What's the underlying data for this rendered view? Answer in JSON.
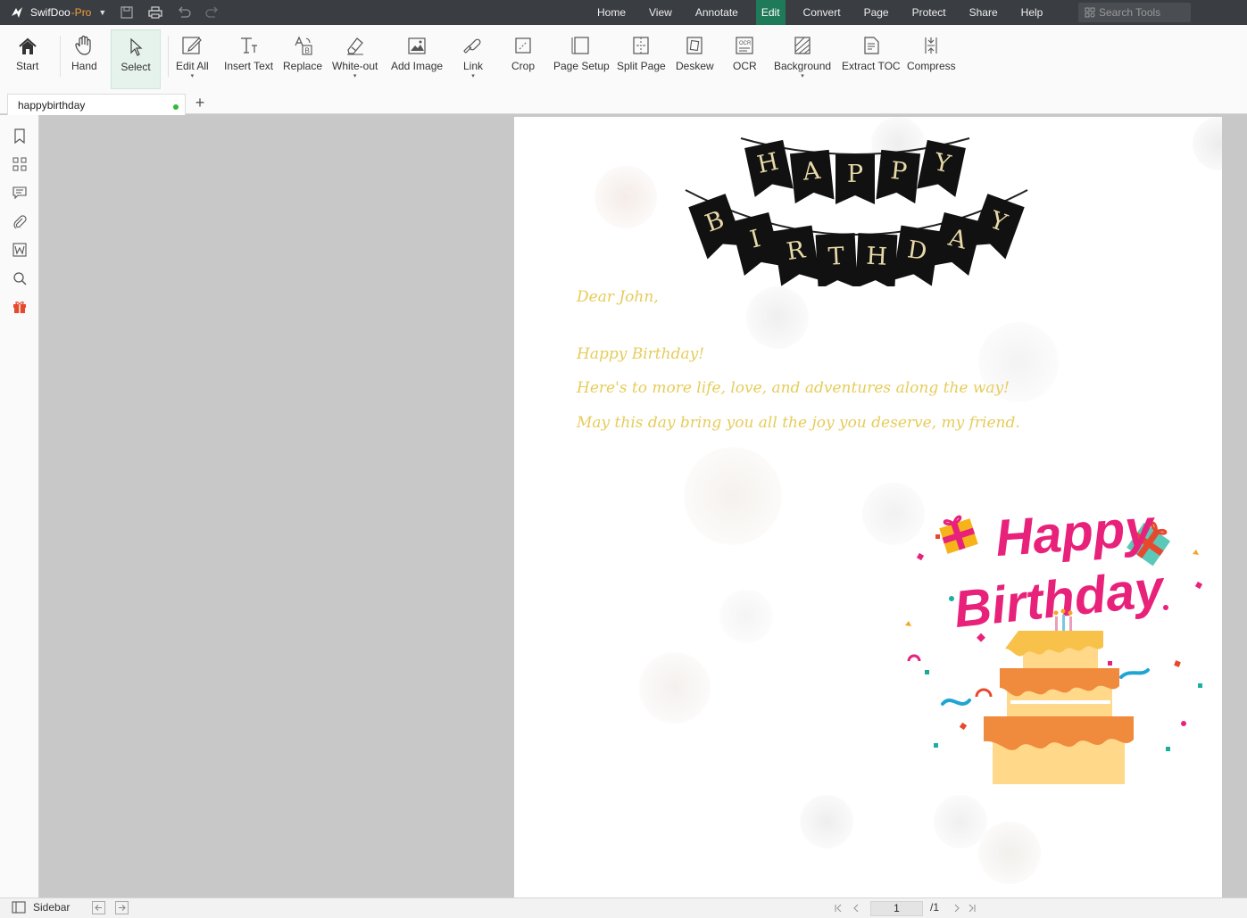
{
  "app": {
    "name": "SwifDoo",
    "edition": "-Pro"
  },
  "menu": {
    "items": [
      {
        "label": "Home"
      },
      {
        "label": "View"
      },
      {
        "label": "Annotate"
      },
      {
        "label": "Edit",
        "active": true
      },
      {
        "label": "Convert"
      },
      {
        "label": "Page"
      },
      {
        "label": "Protect"
      },
      {
        "label": "Share"
      },
      {
        "label": "Help"
      }
    ],
    "search_placeholder": "Search Tools"
  },
  "ribbon": {
    "tools": [
      {
        "id": "start",
        "label": "Start",
        "icon": "home-icon"
      },
      {
        "id": "hand",
        "label": "Hand",
        "icon": "hand-icon"
      },
      {
        "id": "select",
        "label": "Select",
        "icon": "cursor-icon",
        "selected": true
      },
      {
        "id": "edit-all",
        "label": "Edit All",
        "icon": "edit-icon",
        "dropdown": true
      },
      {
        "id": "insert-text",
        "label": "Insert Text",
        "icon": "text-icon"
      },
      {
        "id": "replace",
        "label": "Replace",
        "icon": "replace-icon"
      },
      {
        "id": "white-out",
        "label": "White-out",
        "icon": "eraser-icon",
        "dropdown": true
      },
      {
        "id": "add-image",
        "label": "Add Image",
        "icon": "image-icon"
      },
      {
        "id": "link",
        "label": "Link",
        "icon": "link-icon",
        "dropdown": true
      },
      {
        "id": "crop",
        "label": "Crop",
        "icon": "crop-icon"
      },
      {
        "id": "page-setup",
        "label": "Page Setup",
        "icon": "page-setup-icon"
      },
      {
        "id": "split-page",
        "label": "Split Page",
        "icon": "split-page-icon"
      },
      {
        "id": "deskew",
        "label": "Deskew",
        "icon": "deskew-icon"
      },
      {
        "id": "ocr",
        "label": "OCR",
        "icon": "ocr-icon"
      },
      {
        "id": "background",
        "label": "Background",
        "icon": "background-icon",
        "dropdown": true
      },
      {
        "id": "extract-toc",
        "label": "Extract TOC",
        "icon": "toc-icon"
      },
      {
        "id": "compress",
        "label": "Compress",
        "icon": "compress-icon"
      }
    ]
  },
  "tabs": {
    "document": "happybirthday",
    "add": "+"
  },
  "document": {
    "banner_top": [
      "H",
      "A",
      "P",
      "P",
      "Y"
    ],
    "banner_bottom": [
      "B",
      "I",
      "R",
      "T",
      "H",
      "D",
      "A",
      "Y"
    ],
    "letter": {
      "greeting": "Dear John,",
      "line1": "Happy Birthday!",
      "line2": "Here's to more life, love, and adventures along the way!",
      "line3": "May this day bring you all the joy you deserve, my friend."
    },
    "graphic_title_1": "Happy",
    "graphic_title_2": "Birthday"
  },
  "statusbar": {
    "sidebar_label": "Sidebar",
    "current_page": "1",
    "total_pages": "/1"
  },
  "colors": {
    "titlebar": "#3a3d42",
    "active_menu": "#1f7a5a",
    "letter_text": "#e6cc5a",
    "graphic_pink": "#e8217a",
    "cake_orange": "#f08a3c"
  }
}
